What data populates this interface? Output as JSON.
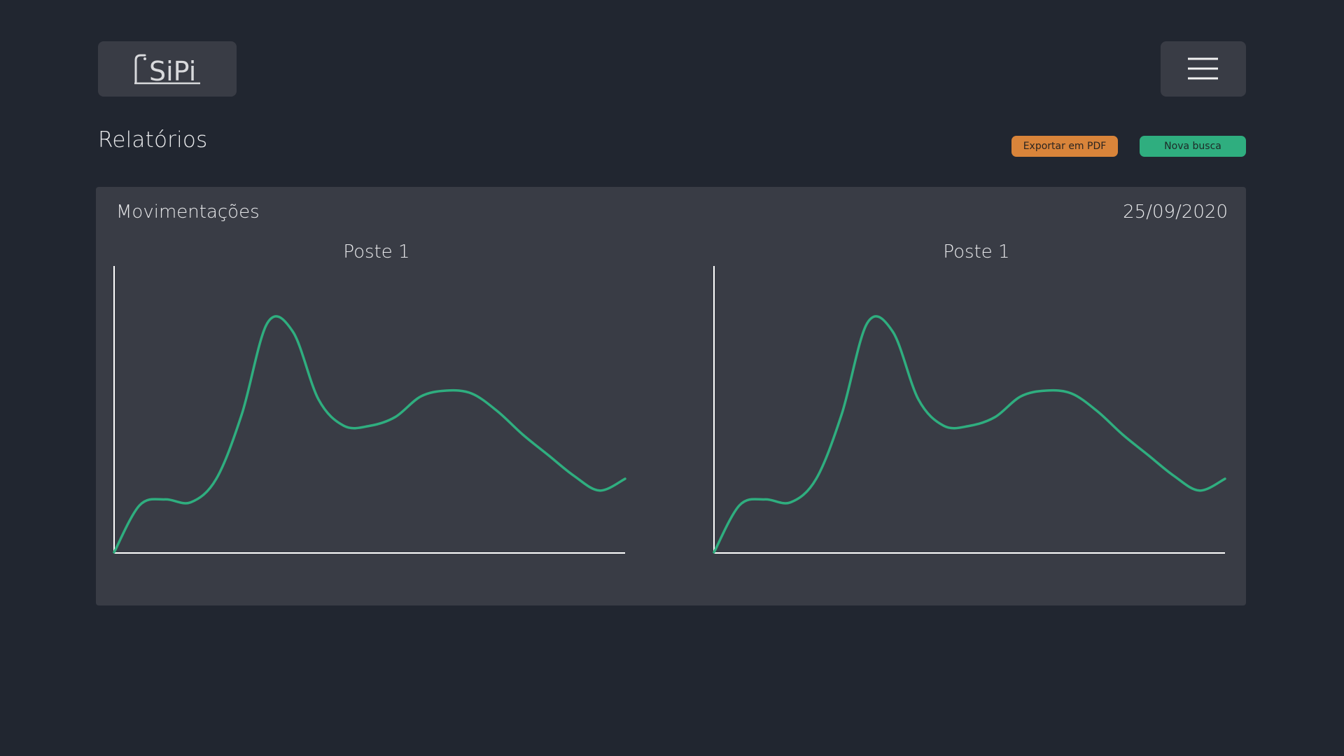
{
  "header": {
    "logo_text": "SiPi",
    "menu_icon": "hamburger-menu-icon"
  },
  "page": {
    "title": "Relatórios"
  },
  "actions": {
    "export_label": "Exportar em PDF",
    "export_color": "#d9843a",
    "new_search_label": "Nova busca",
    "new_search_color": "#2fae7f"
  },
  "panel": {
    "title": "Movimentações",
    "date": "25/09/2020"
  },
  "colors": {
    "background": "#212630",
    "surface": "#393c45",
    "line": "#2fae7f",
    "axis": "#ffffff"
  },
  "chart_data": [
    {
      "type": "line",
      "title": "Poste 1",
      "x": [
        0,
        0.5,
        1,
        1.5,
        2,
        2.5,
        3,
        3.5,
        4,
        4.5,
        5,
        5.5,
        6,
        6.5,
        7,
        7.5,
        8,
        8.5,
        9,
        9.5,
        10
      ],
      "y": [
        0,
        16,
        18,
        17,
        25,
        47,
        78,
        75,
        52,
        43,
        43,
        46,
        53,
        55,
        54,
        48,
        40,
        33,
        26,
        21,
        25
      ],
      "ylim": [
        0,
        100
      ],
      "xlim": [
        0,
        10
      ],
      "grid": false,
      "xlabel": "",
      "ylabel": ""
    },
    {
      "type": "line",
      "title": "Poste 1",
      "x": [
        0,
        0.5,
        1,
        1.5,
        2,
        2.5,
        3,
        3.5,
        4,
        4.5,
        5,
        5.5,
        6,
        6.5,
        7,
        7.5,
        8,
        8.5,
        9,
        9.5,
        10
      ],
      "y": [
        0,
        16,
        18,
        17,
        25,
        47,
        78,
        75,
        52,
        43,
        43,
        46,
        53,
        55,
        54,
        48,
        40,
        33,
        26,
        21,
        25
      ],
      "ylim": [
        0,
        100
      ],
      "xlim": [
        0,
        10
      ],
      "grid": false,
      "xlabel": "",
      "ylabel": ""
    }
  ]
}
